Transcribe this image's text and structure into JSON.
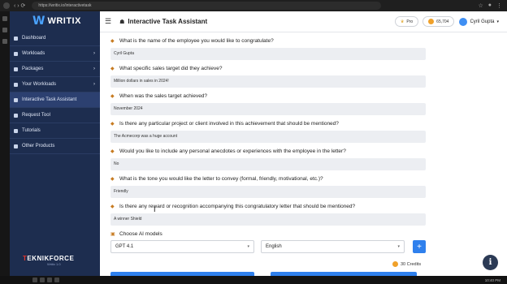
{
  "browser": {
    "url": "https://writix.io/interactivetask"
  },
  "sidebar": {
    "logo_mark": "W",
    "logo_text": "WRITIX",
    "items": [
      {
        "label": "Dashboard",
        "icon": "dashboard-icon",
        "has_chevron": false
      },
      {
        "label": "Workloads",
        "icon": "workloads-icon",
        "has_chevron": true
      },
      {
        "label": "Packages",
        "icon": "packages-icon",
        "has_chevron": true
      },
      {
        "label": "Your Workloads",
        "icon": "folder-icon",
        "has_chevron": true
      },
      {
        "label": "Interactive Task Assistant",
        "icon": "user-icon",
        "has_chevron": false,
        "active": true
      },
      {
        "label": "Request Tool",
        "icon": "tool-icon",
        "has_chevron": false
      },
      {
        "label": "Tutorials",
        "icon": "video-icon",
        "has_chevron": false
      },
      {
        "label": "Other Products",
        "icon": "grid-icon",
        "has_chevron": false
      }
    ],
    "brand_prefix": "T",
    "brand_rest": "EKNIKFORCE",
    "brand_sub": "Writix 1.0"
  },
  "header": {
    "title": "Interactive Task Assistant",
    "pro_label": "Pro",
    "credits_label": "65,704",
    "user_name": "Cyril Gupta"
  },
  "form": {
    "questions": [
      {
        "q": "What is the name of the employee you would like to congratulate?",
        "a": "Cyril Gupta"
      },
      {
        "q": "What specific sales target did they achieve?",
        "a": "Million dollars in sales in 2024!"
      },
      {
        "q": "When was the sales target achieved?",
        "a": "November 2024"
      },
      {
        "q": "Is there any particular project or client involved in this achievement that should be mentioned?",
        "a": "The Acmecorp was a huge account"
      },
      {
        "q": "Would you like to include any personal anecdotes or experiences with the employee in the letter?",
        "a": "No"
      },
      {
        "q": "What is the tone you would like the letter to convey (formal, friendly, motivational, etc.)?",
        "a": "Friendly"
      },
      {
        "q": "Is there any reward or recognition accompanying this congratulatory letter that should be mentioned?",
        "a": "A winner Shield"
      }
    ],
    "models_label": "Choose AI models",
    "model_value": "GPT 4.1",
    "language_value": "English",
    "credits_note": "30 Credits"
  },
  "taskbar": {
    "time": "10:40 PM"
  },
  "colors": {
    "sidebar": "#1d2d4f",
    "accent": "#2f80ed"
  }
}
